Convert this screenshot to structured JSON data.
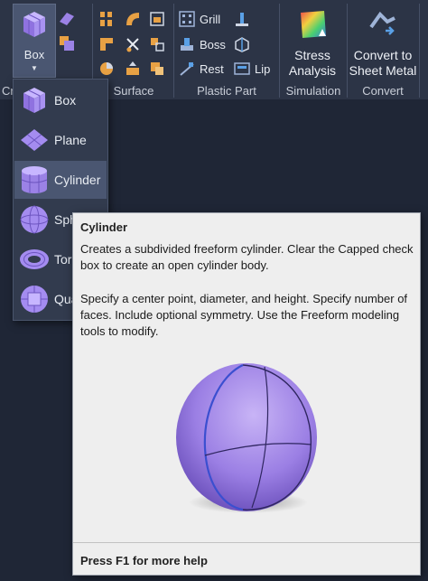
{
  "ribbon": {
    "box_label": "Box",
    "partial_panel_label": "Cr",
    "panels": {
      "surface": "Surface",
      "plastic_part": "Plastic Part",
      "simulation": "Simulation",
      "convert": "Convert"
    },
    "plastic": {
      "grill": "Grill",
      "boss": "Boss",
      "rest": "Rest",
      "lip": "Lip"
    },
    "stress_line1": "Stress",
    "stress_line2": "Analysis",
    "convert_line1": "Convert to",
    "convert_line2": "Sheet Metal"
  },
  "dropdown": {
    "items": [
      {
        "label": "Box",
        "icon": "box-icon"
      },
      {
        "label": "Plane",
        "icon": "plane-icon"
      },
      {
        "label": "Cylinder",
        "icon": "cylinder-icon",
        "selected": true
      },
      {
        "label": "Sph",
        "icon": "sphere-icon"
      },
      {
        "label": "Toru",
        "icon": "torus-icon"
      },
      {
        "label": "Qua",
        "icon": "quadball-icon"
      }
    ]
  },
  "tooltip": {
    "title": "Cylinder",
    "paragraph1": "Creates a subdivided freeform cylinder. Clear the Capped check box to create an open cylinder body.",
    "paragraph2": "Specify a center point, diameter, and height. Specify number of faces. Include optional symmetry. Use the Freeform modeling tools to modify.",
    "footer": "Press F1 for more help"
  },
  "colors": {
    "ribbon_bg": "#2c3446",
    "app_bg": "#1f2636",
    "freeform_purple": "#9b82e6",
    "tooltip_bg": "#eeeeee"
  }
}
